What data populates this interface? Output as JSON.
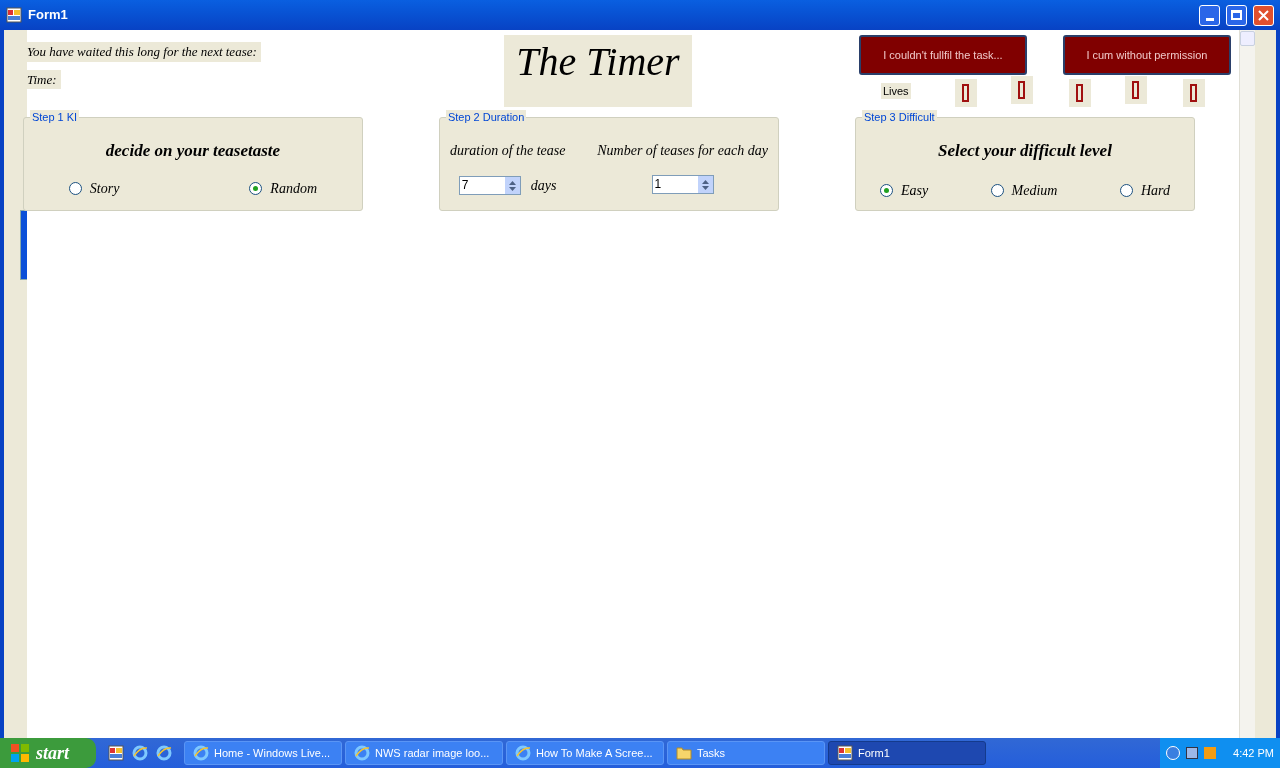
{
  "window": {
    "title": "Form1"
  },
  "wait_label": "You have waited this long for the next tease:",
  "time_label": "Time:",
  "heading": "The Timer",
  "buttons": [
    {
      "label": "I couldn't fullfil the task..."
    },
    {
      "label": "I cum without permission"
    }
  ],
  "lives": {
    "label": "Lives",
    "markers": [
      {
        "kind": "box"
      },
      {
        "kind": "box"
      },
      {
        "kind": "box"
      },
      {
        "kind": "box"
      },
      {
        "kind": "box"
      }
    ]
  },
  "step1": {
    "title": "Step 1 KI",
    "prompt": "decide on your teasetaste",
    "options": [
      {
        "label": "Story",
        "selected": false
      },
      {
        "label": "Random",
        "selected": true
      }
    ]
  },
  "step2": {
    "title": "Step 2 Duration",
    "duration_label": "duration of the tease",
    "duration_value": "7",
    "days_label": "days",
    "count_label": "Number of teases for each day",
    "count_value": "1"
  },
  "step3": {
    "title": "Step 3 Difficult",
    "prompt": "Select your difficult level",
    "options": [
      {
        "label": "Easy",
        "selected": true
      },
      {
        "label": "Medium",
        "selected": false
      },
      {
        "label": "Hard",
        "selected": false
      }
    ]
  },
  "taskbar": {
    "start": "start",
    "tasks": [
      {
        "label": "Home - Windows Live...",
        "kind": "browser",
        "selected": false
      },
      {
        "label": "NWS radar image loo...",
        "kind": "browser",
        "selected": false
      },
      {
        "label": "How To Make A Scree...",
        "kind": "browser",
        "selected": false
      },
      {
        "label": "Tasks",
        "kind": "folder",
        "selected": false
      },
      {
        "label": "Form1",
        "kind": "form",
        "selected": true
      }
    ],
    "clock": "4:42 PM"
  }
}
